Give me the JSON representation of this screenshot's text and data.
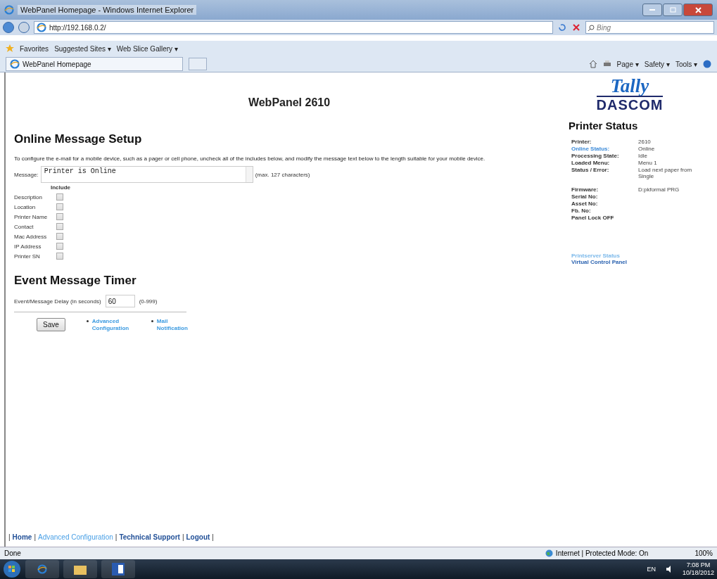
{
  "window": {
    "title": "WebPanel Homepage - Windows Internet Explorer"
  },
  "address_bar": {
    "url": "http://192.168.0.2/",
    "search_placeholder": "Bing"
  },
  "favorites_bar": {
    "label": "Favorites",
    "items": [
      "Suggested Sites ▾",
      "Web Slice Gallery ▾"
    ]
  },
  "tab": {
    "title": "WebPanel Homepage"
  },
  "command_bar": {
    "items": [
      "Page ▾",
      "Safety ▾",
      "Tools ▾"
    ]
  },
  "page": {
    "title": "WebPanel 2610",
    "logo": {
      "top": "Tally",
      "bottom": "DASCOM"
    },
    "online_message": {
      "heading": "Online Message Setup",
      "instructions": "To configure the e-mail for a mobile device, such as a pager or cell phone, uncheck all of the includes below, and modify the message text below to the length suitable for your mobile device.",
      "message_label": "Message:",
      "message_value": "Printer is Online",
      "message_note": "(max. 127 characters)",
      "include_header": "Include",
      "includes": [
        {
          "label": "Description",
          "checked": false
        },
        {
          "label": "Location",
          "checked": false
        },
        {
          "label": "Printer Name",
          "checked": false
        },
        {
          "label": "Contact",
          "checked": false
        },
        {
          "label": "Mac Address",
          "checked": false
        },
        {
          "label": "IP Address",
          "checked": false
        },
        {
          "label": "Printer SN",
          "checked": false
        }
      ]
    },
    "event_timer": {
      "heading": "Event Message Timer",
      "delay_label": "Event/Message Delay (in seconds)",
      "delay_value": "60",
      "range": "(0-999)"
    },
    "save_button": "Save",
    "links": [
      "Advanced Configuration",
      "Mail Notification"
    ],
    "printer_status": {
      "heading": "Printer Status",
      "groups": [
        [
          {
            "label": "Printer:",
            "value": "2610",
            "kind": "plain"
          },
          {
            "label": "Online Status:",
            "value": "Online",
            "kind": "link"
          },
          {
            "label": "Processing State:",
            "value": "Idle",
            "kind": "plain"
          },
          {
            "label": "Loaded Menu:",
            "value": "Menu 1",
            "kind": "plain"
          },
          {
            "label": "Status / Error:",
            "value": "Load next paper from Single",
            "kind": "plain"
          }
        ],
        [
          {
            "label": "Firmware:",
            "value": "D:pkformal PRG",
            "kind": "plain"
          },
          {
            "label": "Serial No:",
            "kind": "plain"
          },
          {
            "label": "Asset No:",
            "kind": "plain"
          },
          {
            "label": "Fb. No:",
            "kind": "plain"
          },
          {
            "label": "Panel Lock OFF",
            "kind": "plain"
          }
        ]
      ],
      "links": [
        {
          "label": "Printserver Status",
          "kind": "light"
        },
        {
          "label": "Virtual Control Panel",
          "kind": "bold"
        }
      ]
    },
    "footer_separator": "|",
    "footer_nav": [
      {
        "label": "Home",
        "kind": "bold"
      },
      {
        "label": "Advanced Configuration",
        "kind": "light"
      },
      {
        "label": "Technical Support",
        "kind": "bold"
      },
      {
        "label": "Logout",
        "kind": "bold"
      }
    ]
  },
  "status_bar": {
    "text": "Done",
    "zone": "Internet | Protected Mode: On",
    "zoom": "100%"
  },
  "taskbar": {
    "language": "EN",
    "time": "7:08 PM",
    "date": "10/18/2012"
  }
}
